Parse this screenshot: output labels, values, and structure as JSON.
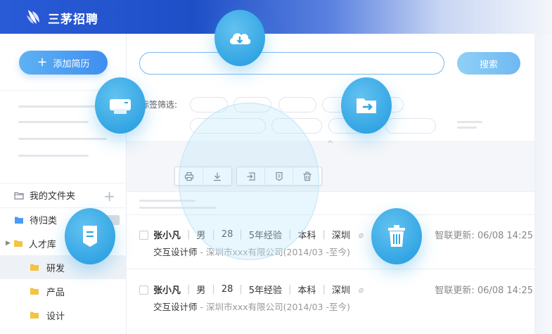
{
  "header": {
    "brand": "三茅招聘"
  },
  "sidebar": {
    "add_resume_label": "添加简历",
    "my_folder_label": "我的文件夹",
    "pending_label": "待归类",
    "talent_pool_label": "人才库",
    "folders": [
      "研发",
      "产品",
      "设计"
    ]
  },
  "search": {
    "placeholder": "",
    "button_label": "搜索"
  },
  "filters": {
    "tag_label": "标签筛选:"
  },
  "candidates": [
    {
      "name": "张小凡",
      "gender": "男",
      "age": "28",
      "experience": "5年经验",
      "education": "本科",
      "city": "深圳",
      "update_label": "智联更新:",
      "update_time": "06/08 14:25",
      "role": "交互设计师",
      "company": " - 深圳市xxx有限公司(2014/03 -至今)"
    },
    {
      "name": "张小凡",
      "gender": "男",
      "age": "28",
      "experience": "5年经验",
      "education": "本科",
      "city": "深圳",
      "update_label": "智联更新:",
      "update_time": "06/08 14:25",
      "role": "交互设计师",
      "company": " - 深圳市xxx有限公司(2014/03 -至今)"
    }
  ],
  "toolbar_icons": [
    "print-icon",
    "download-icon",
    "move-icon",
    "tag-icon",
    "delete-icon"
  ],
  "feature_icons": [
    "cloud-download-icon",
    "printer-icon",
    "folder-move-icon",
    "bookmark-icon",
    "trash-icon"
  ],
  "colors": {
    "primary": "#3e8ef0",
    "accent": "#34a6e4",
    "header": "#1f4fc7"
  }
}
